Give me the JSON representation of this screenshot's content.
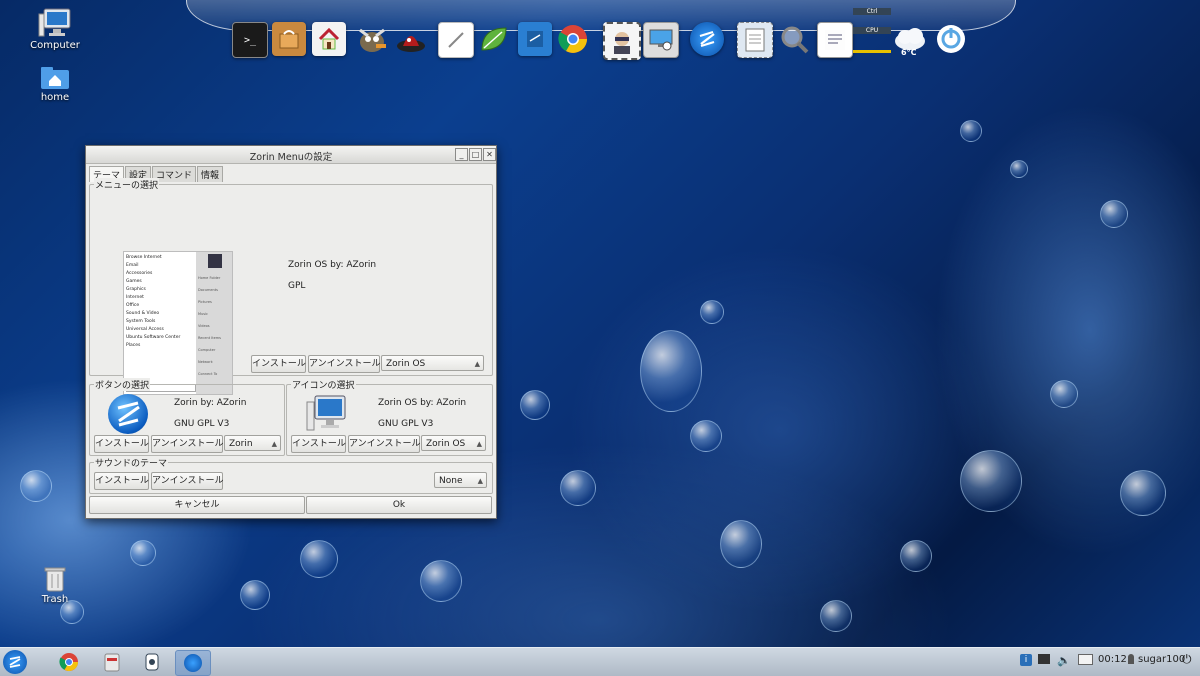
{
  "desktop": {
    "icons": [
      {
        "id": "computer",
        "label": "Computer"
      },
      {
        "id": "home",
        "label": "home"
      },
      {
        "id": "trash",
        "label": "Trash"
      }
    ]
  },
  "dock": {
    "items": [
      "terminal-icon",
      "package-icon",
      "home-folder-icon",
      "gimp-icon",
      "wine-icon",
      "pencil-icon",
      "leaf-icon",
      "notepad-icon",
      "chrome-icon",
      "avatar-icon",
      "screenshot-icon",
      "zorin-icon",
      "clipboard-icon",
      "search-icon",
      "notes-icon",
      "cpu-monitor-icon",
      "weather-icon",
      "power-icon"
    ],
    "weather_temp": "6°C",
    "cpu_label": "CPU",
    "ctrl_label": "Ctrl"
  },
  "dialog": {
    "title": "Zorin Menuの設定",
    "tabs": [
      "テーマ",
      "設定",
      "コマンド",
      "情報"
    ],
    "menu_section": {
      "label": "メニューの選択",
      "author": "Zorin OS by: AZorin",
      "license": "GPL",
      "install": "インストール",
      "uninstall": "アンインストール",
      "selected": "Zorin OS",
      "preview_items": [
        "Browse Internet",
        "Email",
        "Accessories",
        "Games",
        "Graphics",
        "Internet",
        "Office",
        "Sound & Video",
        "System Tools",
        "Universal Access",
        "Ubuntu Software Center",
        "Places"
      ],
      "preview_side": [
        "Home Folder",
        "Documents",
        "Pictures",
        "Music",
        "Videos",
        "Recent Items",
        "Computer",
        "Network",
        "Connect To",
        "Universal Access",
        "System Settings",
        "Help"
      ]
    },
    "button_section": {
      "label": "ボタンの選択",
      "author": "Zorin by: AZorin",
      "license": "GNU GPL V3",
      "install": "インストール",
      "uninstall": "アンインストール",
      "selected": "Zorin"
    },
    "icon_section": {
      "label": "アイコンの選択",
      "author": "Zorin OS by: AZorin",
      "license": "GNU GPL V3",
      "install": "インストール",
      "uninstall": "アンインストール",
      "selected": "Zorin OS"
    },
    "sound_section": {
      "label": "サウンドのテーマ",
      "install": "インストール",
      "uninstall": "アンインストール",
      "selected": "None"
    },
    "cancel": "キャンセル",
    "ok": "Ok"
  },
  "taskbar": {
    "clock": "00:12",
    "user": "sugar100"
  }
}
